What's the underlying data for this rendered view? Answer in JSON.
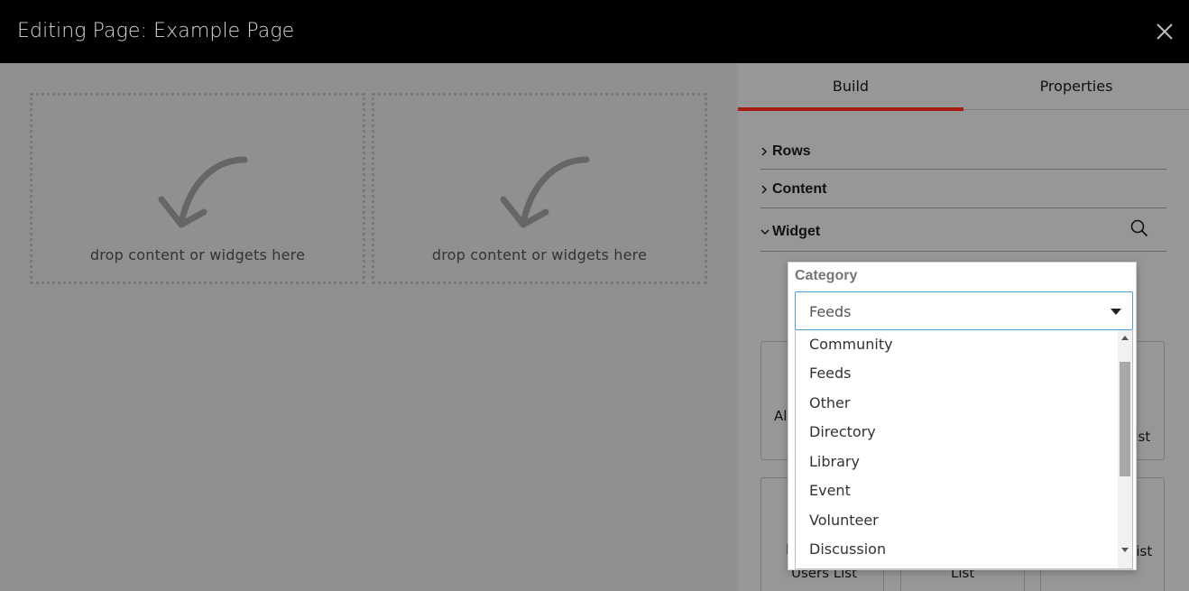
{
  "header": {
    "title": "Editing Page: Example Page",
    "close_icon": "close-icon"
  },
  "canvas": {
    "dropzones": [
      {
        "text": "drop content or widgets here"
      },
      {
        "text": "drop content or widgets here"
      }
    ]
  },
  "panel": {
    "tabs": [
      {
        "label": "Build",
        "active": true
      },
      {
        "label": "Properties",
        "active": false
      }
    ],
    "sections": [
      {
        "label": "Rows",
        "expanded": false
      },
      {
        "label": "Content",
        "expanded": false
      },
      {
        "label": "Widget",
        "expanded": true
      }
    ],
    "widget_cards_partial": [
      "All",
      "List",
      "M",
      "Users List",
      "List",
      "List"
    ]
  },
  "category": {
    "label": "Category",
    "selected": "Feeds",
    "options": [
      "Community",
      "Feeds",
      "Other",
      "Directory",
      "Library",
      "Event",
      "Volunteer",
      "Discussion"
    ]
  },
  "colors": {
    "accent": "#a51f12",
    "focus_border": "#4a9fd6",
    "header_bg": "#000000"
  }
}
